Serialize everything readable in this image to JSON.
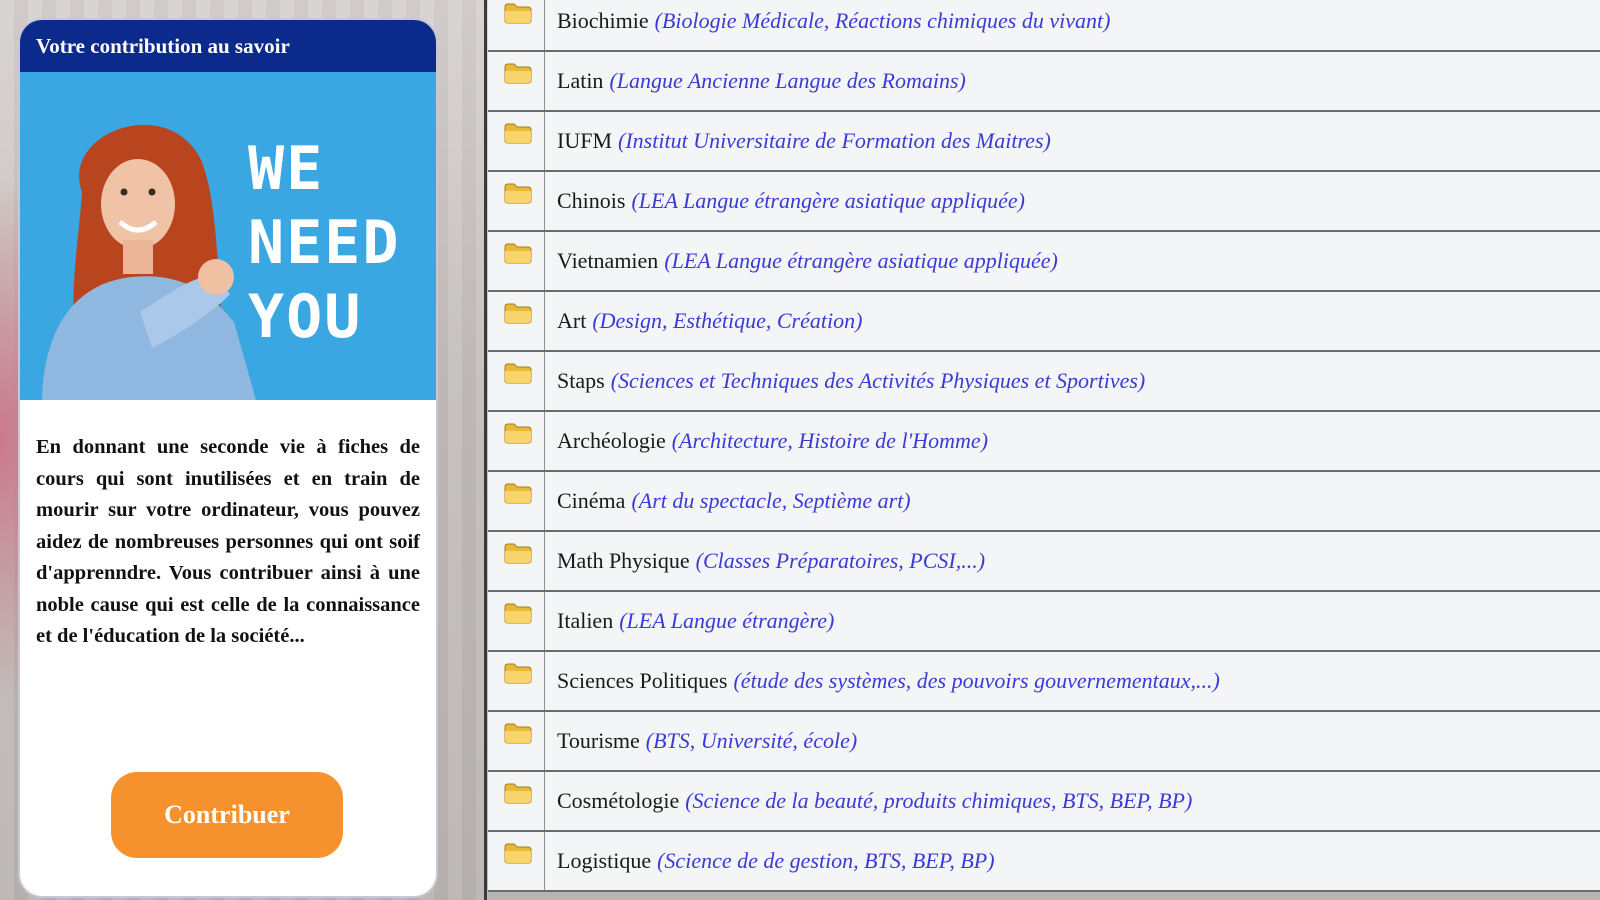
{
  "card": {
    "title": "Votre contribution au savoir",
    "hero_lines": [
      "WE",
      "NEED",
      "YOU"
    ],
    "body": "En donnant une seconde vie à fiches de cours qui sont inutilisées et en train de mourir sur votre ordinateur, vous pouvez aidez de nombreuses personnes qui ont soif d'apprenndre. Vous contribuer ainsi à une noble cause qui est celle de la connaissance et de l'éducation de la société...",
    "button_label": "Contribuer"
  },
  "subjects": [
    {
      "name": "Biochimie",
      "desc": "(Biologie Médicale, Réactions chimiques du vivant)"
    },
    {
      "name": "Latin",
      "desc": "(Langue Ancienne Langue des Romains)"
    },
    {
      "name": "IUFM",
      "desc": "(Institut Universitaire de Formation des Maitres)"
    },
    {
      "name": "Chinois",
      "desc": "(LEA Langue étrangère asiatique appliquée)"
    },
    {
      "name": "Vietnamien",
      "desc": "(LEA Langue étrangère asiatique appliquée)"
    },
    {
      "name": "Art",
      "desc": "(Design, Esthétique, Création)"
    },
    {
      "name": "Staps",
      "desc": "(Sciences et Techniques des Activités Physiques et Sportives)"
    },
    {
      "name": "Archéologie",
      "desc": "(Architecture, Histoire de l'Homme)"
    },
    {
      "name": "Cinéma",
      "desc": "(Art du spectacle, Septième art)"
    },
    {
      "name": "Math Physique",
      "desc": "(Classes Préparatoires, PCSI,...)"
    },
    {
      "name": "Italien",
      "desc": "(LEA Langue étrangère)"
    },
    {
      "name": "Sciences Politiques",
      "desc": "(étude des systèmes, des pouvoirs gouvernementaux,...)"
    },
    {
      "name": "Tourisme",
      "desc": "(BTS, Université, école)"
    },
    {
      "name": "Cosmétologie",
      "desc": "(Science de la beauté, produits chimiques, BTS, BEP, BP)"
    },
    {
      "name": "Logistique",
      "desc": "(Science de de gestion, BTS, BEP, BP)"
    }
  ],
  "icons": {
    "row_icon": "folder-icon"
  },
  "colors": {
    "header_bg": "#0b2a8c",
    "hero_bg": "#3aa6e2",
    "button_bg": "#f5922e",
    "desc_text": "#3a3ad6"
  }
}
